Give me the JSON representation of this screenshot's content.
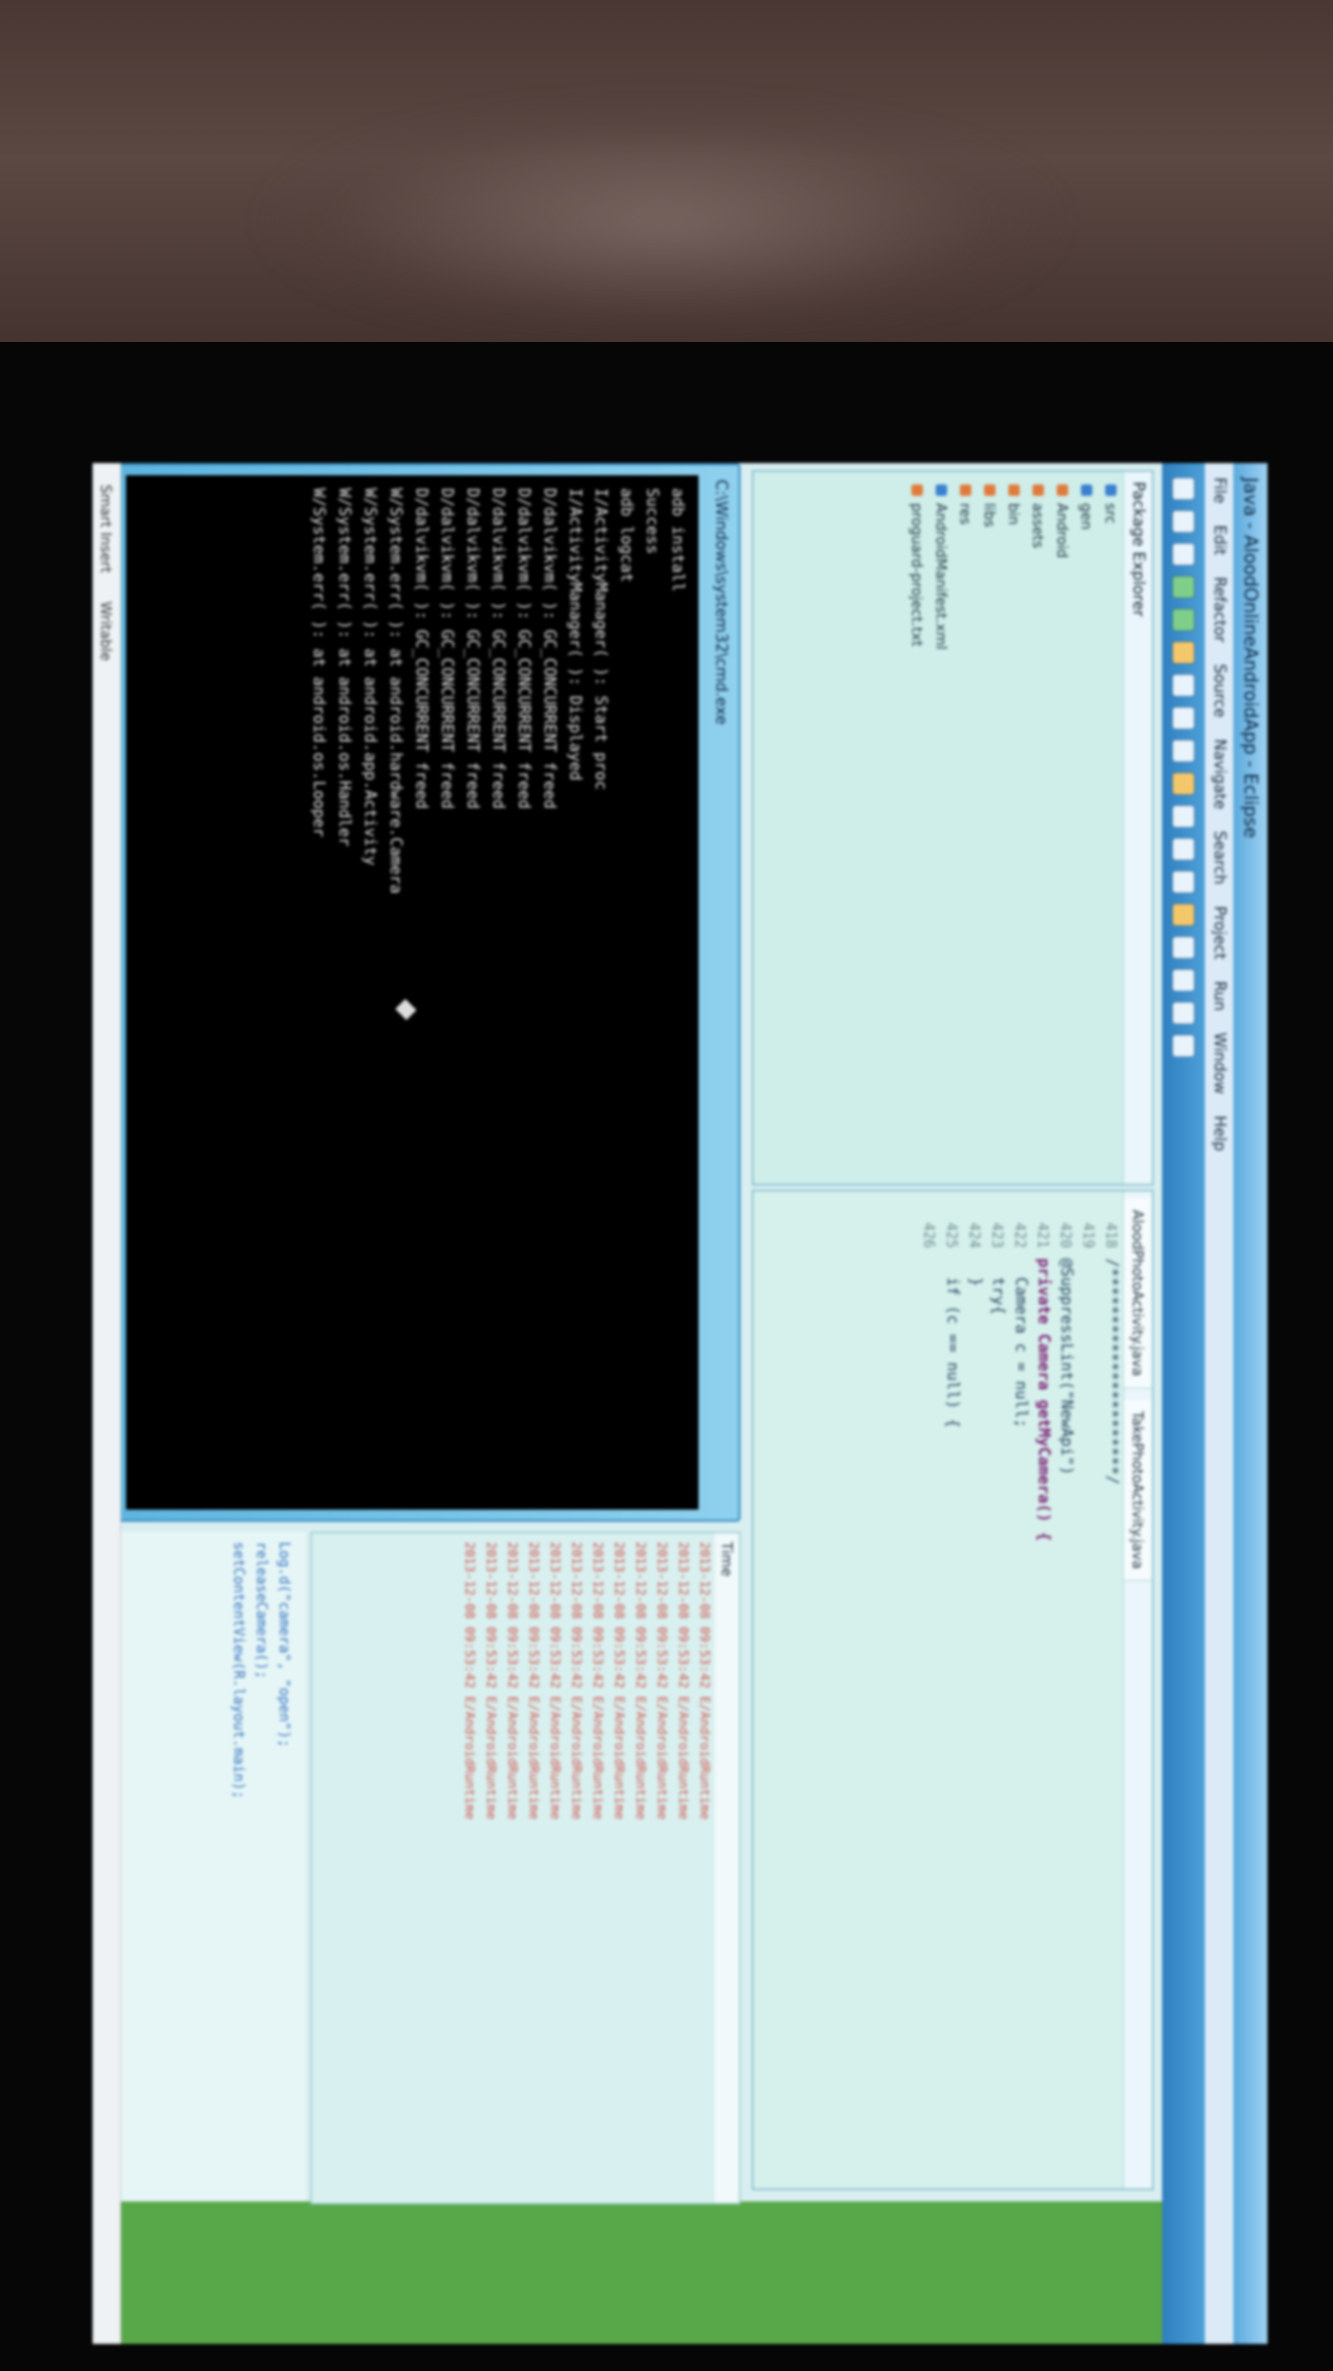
{
  "window": {
    "title": "Java - AloodOnlineAndroidApp - Eclipse"
  },
  "menu": [
    "File",
    "Edit",
    "Refactor",
    "Source",
    "Navigate",
    "Search",
    "Project",
    "Run",
    "Window",
    "Help"
  ],
  "package_explorer": {
    "title": "Package Explorer",
    "items": [
      "src",
      "gen",
      "Android",
      "assets",
      "bin",
      "libs",
      "res",
      "AndroidManifest.xml",
      "proguard-project.txt"
    ]
  },
  "editor": {
    "tabs": [
      "AloodPhotoActivity.java",
      "TakePhotoActivity.java"
    ],
    "line_numbers": [
      "418",
      "419",
      "420",
      "421",
      "422",
      "423",
      "424",
      "425",
      "426"
    ],
    "lines": [
      "/**********************/",
      "",
      "@SuppressLint(\"NewApi\")",
      "private Camera getMyCamera() {",
      "  Camera c = null;",
      "  try{",
      "  }",
      "  if (c == null) {",
      ""
    ]
  },
  "console": {
    "title": "C:\\Windows\\system32\\cmd.exe",
    "lines": [
      "adb install",
      "Success",
      "adb logcat",
      "I/ActivityManager( ): Start proc",
      "I/ActivityManager( ): Displayed",
      "D/dalvikvm( ): GC_CONCURRENT freed",
      "D/dalvikvm( ): GC_CONCURRENT freed",
      "D/dalvikvm( ): GC_CONCURRENT freed",
      "D/dalvikvm( ): GC_CONCURRENT freed",
      "D/dalvikvm( ): GC_CONCURRENT freed",
      "D/dalvikvm( ): GC_CONCURRENT freed",
      "W/System.err( ): at android.hardware.Camera",
      "W/System.err( ): at android.app.Activity",
      "W/System.err( ): at android.os.Handler",
      "W/System.err( ): at android.os.Looper"
    ]
  },
  "log": {
    "header": "Time",
    "rows": [
      "2013-12-08 09:53:42 E/AndroidRuntime",
      "2013-12-08 09:53:42 E/AndroidRuntime",
      "2013-12-08 09:53:42 E/AndroidRuntime",
      "2013-12-08 09:53:42 E/AndroidRuntime",
      "2013-12-08 09:53:42 E/AndroidRuntime",
      "2013-12-08 09:53:42 E/AndroidRuntime",
      "2013-12-08 09:53:42 E/AndroidRuntime",
      "2013-12-08 09:53:42 E/AndroidRuntime",
      "2013-12-08 09:53:42 E/AndroidRuntime",
      "2013-12-08 09:53:42 E/AndroidRuntime",
      "2013-12-08 09:53:42 E/AndroidRuntime",
      "2013-12-08 09:53:42 E/AndroidRuntime"
    ]
  },
  "lower_code": [
    "Log.d(\"camera\", \"open\");",
    "releaseCamera();",
    "setContentView(R.layout.main);"
  ],
  "status": [
    "Smart Insert",
    "Writable"
  ],
  "colors": {
    "titlebar": "#5aa9dd",
    "toolbar": "#2e7fbf",
    "console_bg": "#000000",
    "log_text": "#d0524a"
  }
}
